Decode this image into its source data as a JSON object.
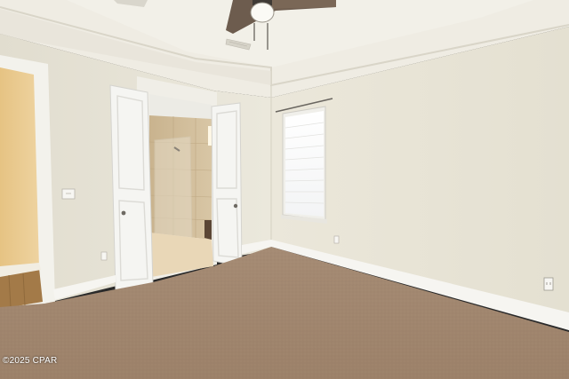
{
  "watermark": {
    "text": "©2025 CPAR"
  },
  "colors": {
    "wall": "#e9e5d8",
    "ceiling": "#efece3",
    "carpet": "#a88d76",
    "trim": "#f4f3ee",
    "door": "#f5f5f2",
    "bath_tile": "#cdb996",
    "closet_wall": "#e7c98c"
  },
  "icons": {
    "fan": "ceiling-fan-icon",
    "vent": "air-vent-icon",
    "switch": "light-switch-icon",
    "outlet": "wall-outlet-icon"
  }
}
